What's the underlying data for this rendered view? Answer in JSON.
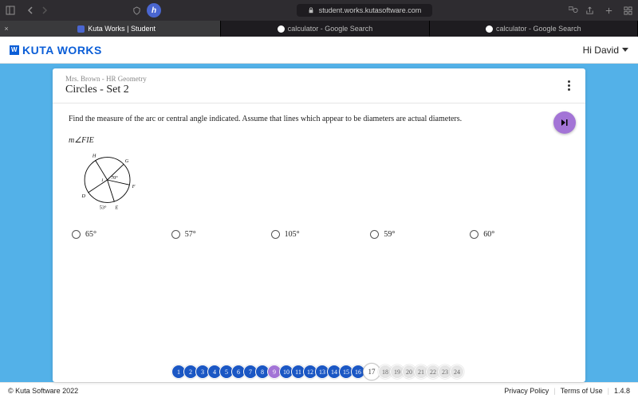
{
  "browser": {
    "url": "student.works.kutasoftware.com",
    "tabs": [
      {
        "label": "Kuta Works | Student",
        "active": true,
        "icon": "kuta"
      },
      {
        "label": "calculator - Google Search",
        "active": false,
        "icon": "g"
      },
      {
        "label": "calculator - Google Search",
        "active": false,
        "icon": "g"
      }
    ]
  },
  "header": {
    "brand": "KUTA WORKS",
    "greeting": "Hi David"
  },
  "assignment": {
    "breadcrumb": "Mrs. Brown - HR Geometry",
    "title": "Circles - Set 2",
    "instructions": "Find the measure of the arc or central angle indicated.  Assume that lines which appear to be diameters are actual diameters.",
    "ask": "m∠FIE",
    "diagram": {
      "center_label": "I",
      "points": [
        "H",
        "G",
        "D",
        "E",
        "F"
      ],
      "angle1": "70°",
      "angle2": "53°"
    },
    "choices": [
      "65°",
      "57°",
      "105°",
      "59°",
      "60°"
    ]
  },
  "nav": {
    "items": [
      {
        "n": 1,
        "c": "blue"
      },
      {
        "n": 2,
        "c": "blue"
      },
      {
        "n": 3,
        "c": "blue"
      },
      {
        "n": 4,
        "c": "blue"
      },
      {
        "n": 5,
        "c": "blue"
      },
      {
        "n": 6,
        "c": "blue"
      },
      {
        "n": 7,
        "c": "blue"
      },
      {
        "n": 8,
        "c": "blue"
      },
      {
        "n": 9,
        "c": "purple"
      },
      {
        "n": 10,
        "c": "blue"
      },
      {
        "n": 11,
        "c": "blue"
      },
      {
        "n": 12,
        "c": "blue"
      },
      {
        "n": 13,
        "c": "blue"
      },
      {
        "n": 14,
        "c": "blue"
      },
      {
        "n": 15,
        "c": "blue"
      },
      {
        "n": 16,
        "c": "blue"
      },
      {
        "n": 17,
        "c": "current"
      },
      {
        "n": 18,
        "c": "gray"
      },
      {
        "n": 19,
        "c": "gray"
      },
      {
        "n": 20,
        "c": "gray"
      },
      {
        "n": 21,
        "c": "gray"
      },
      {
        "n": 22,
        "c": "gray"
      },
      {
        "n": 23,
        "c": "gray"
      },
      {
        "n": 24,
        "c": "gray"
      }
    ]
  },
  "footer": {
    "copyright": "© Kuta Software 2022",
    "privacy": "Privacy Policy",
    "terms": "Terms of Use",
    "version": "1.4.8"
  }
}
